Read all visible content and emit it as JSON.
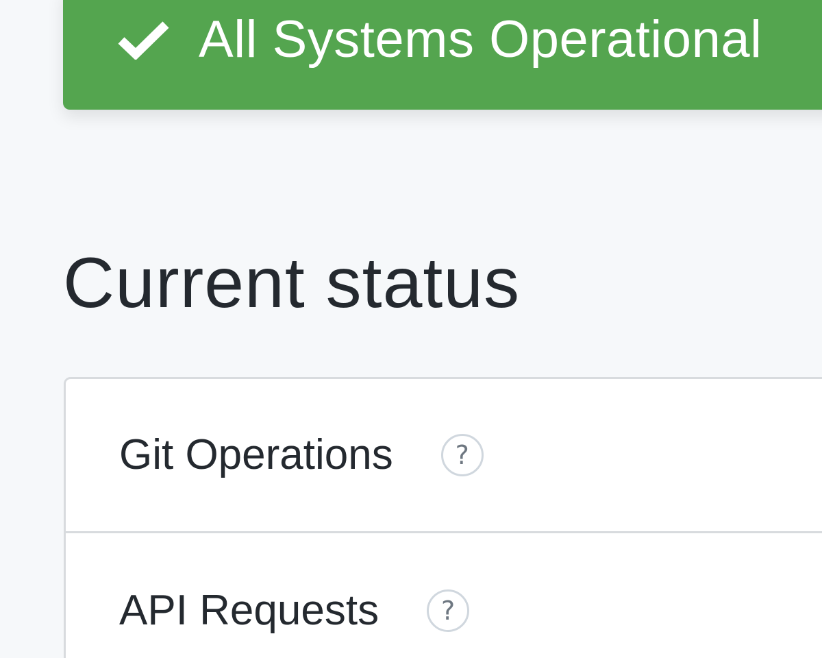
{
  "banner": {
    "status": "All Systems Operational",
    "icon": "check-icon",
    "color": "#54a54f"
  },
  "current_status": {
    "title": "Current status",
    "components": [
      {
        "name": "Git Operations",
        "help_icon": "question-mark-icon",
        "help_glyph": "?"
      },
      {
        "name": "API Requests",
        "help_icon": "question-mark-icon",
        "help_glyph": "?"
      }
    ]
  }
}
